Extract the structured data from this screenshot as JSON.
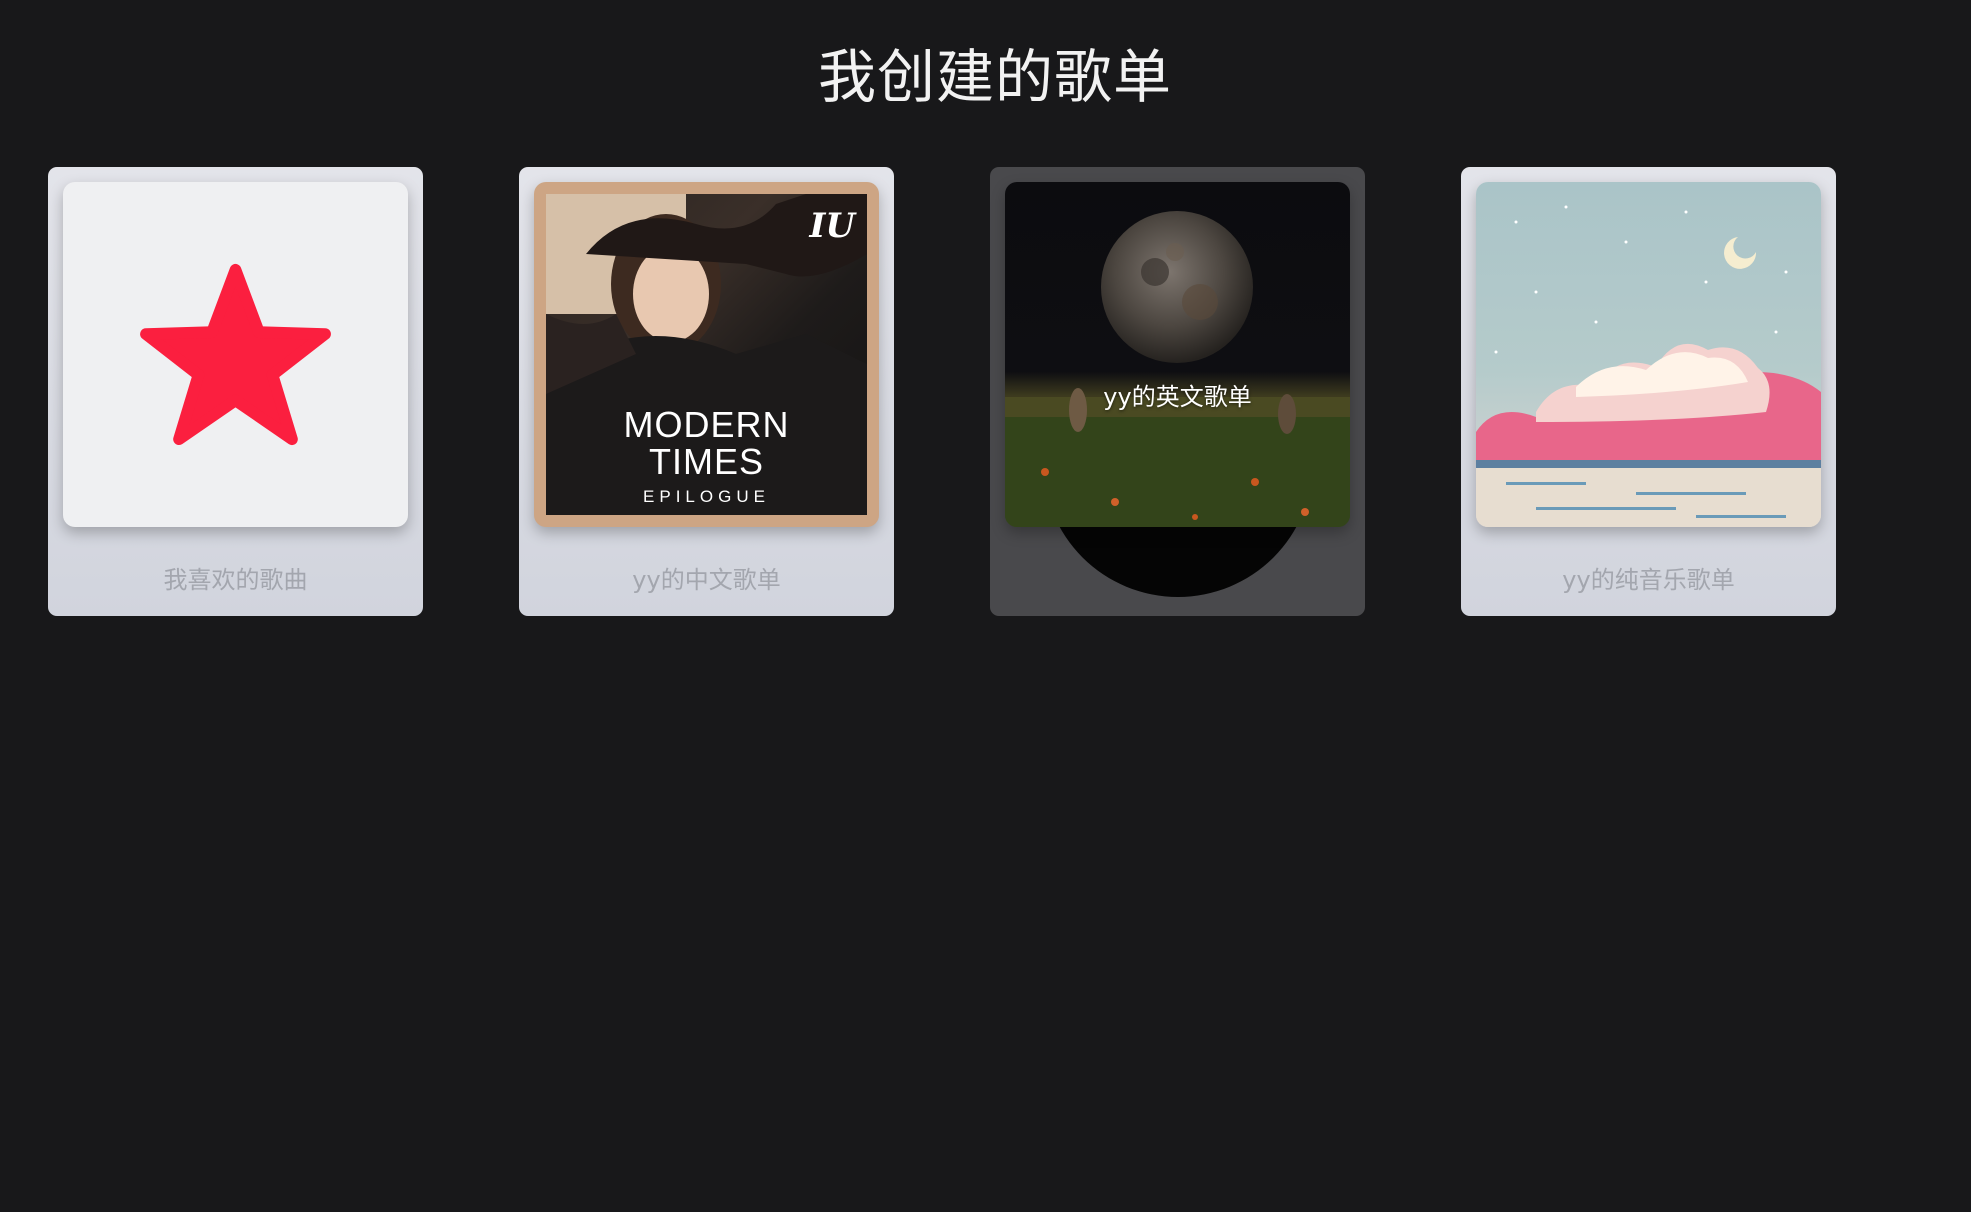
{
  "page": {
    "title": "我创建的歌单"
  },
  "playlists": [
    {
      "label": "我喜欢的歌曲",
      "cover_icon": "star-icon",
      "icon_color": "#fb1f3f"
    },
    {
      "label": "yy的中文歌单",
      "cover": {
        "logo": "IU",
        "line1": "MODERN",
        "line2": "TIMES",
        "line3": "EPILOGUE"
      }
    },
    {
      "label": "yy的英文歌单",
      "state": "hovered"
    },
    {
      "label": "yy的纯音乐歌单"
    }
  ]
}
